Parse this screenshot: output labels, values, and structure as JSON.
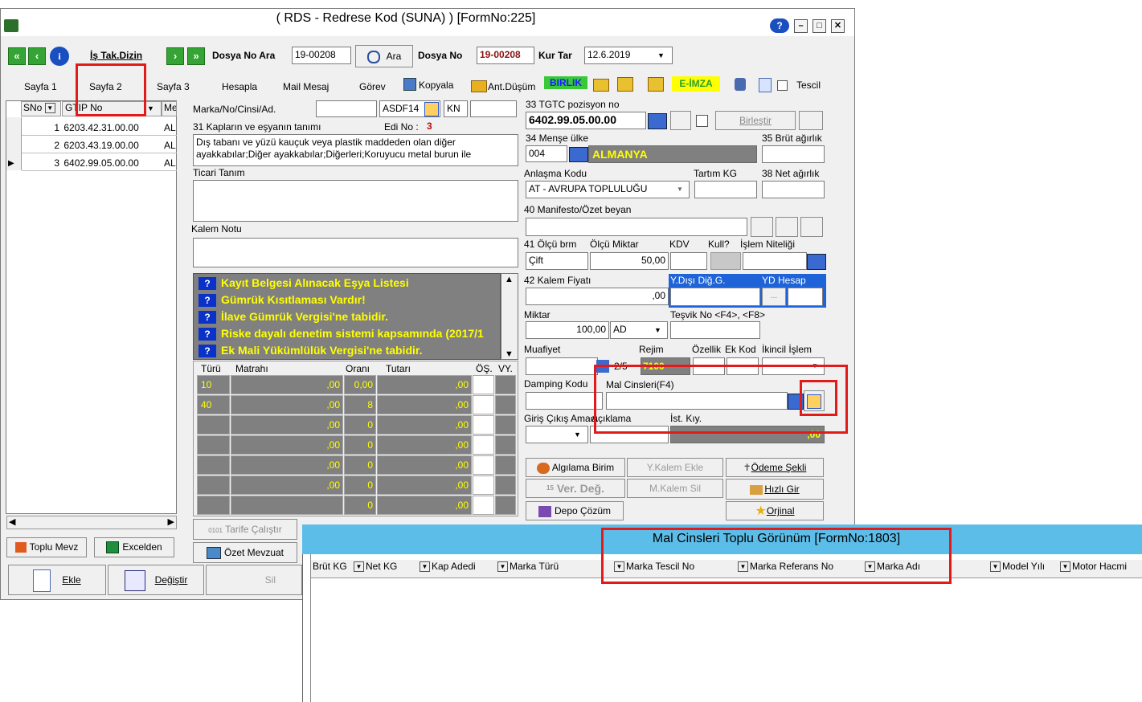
{
  "window": {
    "title": "( RDS - Redrese Kod (SUNA) ) [FormNo:225]",
    "help_label": "?",
    "minimize_label": "–",
    "maximize_label": "□",
    "close_label": "✕"
  },
  "toolbar": {
    "is_tak_dizin": "İş Tak.Dizin",
    "dosya_no_ara_label": "Dosya No Ara",
    "dosya_no_ara_value": "19-00208",
    "ara_button": "Ara",
    "dosya_no_label": "Dosya No",
    "dosya_no_value": "19-00208",
    "kur_tar_label": "Kur Tar",
    "kur_tar_value": "12.6.2019",
    "back2": "«",
    "back1": "‹",
    "fwd1": "›",
    "fwd2": "»"
  },
  "tabs": {
    "sayfa1": "Sayfa 1",
    "sayfa2": "Sayfa 2",
    "sayfa3": "Sayfa 3",
    "hesapla": "Hesapla",
    "mail_mesaj": "Mail Mesaj",
    "gorev": "Görev",
    "kopyala": "Kopyala",
    "ant_dusum": "Ant.Düşüm",
    "birlik": "BIRLIK",
    "e_imza": "E-İMZA",
    "tescil": "Tescil"
  },
  "left_grid": {
    "col_sno": "SNo",
    "col_gtip": "GTIP No",
    "col_me": "Me",
    "rows": [
      {
        "sno": "1",
        "gtip": "6203.42.31.00.00",
        "me": "AL"
      },
      {
        "sno": "2",
        "gtip": "6203.43.19.00.00",
        "me": "AL"
      },
      {
        "sno": "3",
        "gtip": "6402.99.05.00.00",
        "me": "AL"
      }
    ]
  },
  "form": {
    "marka_label": "Marka/No/Cinsi/Ad.",
    "marka_value2": "ASDF14",
    "kn_value": "KN",
    "kaplar_label": "31 Kapların ve eşyanın tanımı",
    "edi_no_label": "Edi No :",
    "edi_no_value": "3",
    "tanim_text": "Dış tabanı ve yüzü kauçuk veya plastik maddeden olan diğer ayakkabılar;Diğer ayakkabılar;Diğerleri;Koruyucu metal burun ile",
    "ticari_tanim_label": "Ticari Tanım",
    "kalem_notu_label": "Kalem Notu",
    "warnings": [
      "Kayıt Belgesi Alınacak Eşya Listesi",
      "Gümrük Kısıtlaması Vardır!",
      "İlave Gümrük Vergisi'ne tabidir.",
      "Riske dayalı denetim sistemi kapsamında (2017/1",
      "Ek Mali Yükümlülük Vergisi'ne tabidir."
    ],
    "warning_icon_label": "?"
  },
  "tax_table": {
    "col_turu": "Türü",
    "col_matrahi": "Matrahı",
    "col_orani": "Oranı",
    "col_tutari": "Tutarı",
    "col_os": "ÖŞ.",
    "col_vy": "VY.",
    "rows": [
      {
        "turu": "10",
        "matrahi": ",00",
        "orani": "0,00",
        "tutari": ",00"
      },
      {
        "turu": "40",
        "matrahi": ",00",
        "orani": "8",
        "tutari": ",00"
      },
      {
        "turu": "",
        "matrahi": ",00",
        "orani": "0",
        "tutari": ",00"
      },
      {
        "turu": "",
        "matrahi": ",00",
        "orani": "0",
        "tutari": ",00"
      },
      {
        "turu": "",
        "matrahi": ",00",
        "orani": "0",
        "tutari": ",00"
      },
      {
        "turu": "",
        "matrahi": ",00",
        "orani": "0",
        "tutari": ",00"
      },
      {
        "turu": "",
        "matrahi": "",
        "orani": "0",
        "tutari": ",00"
      }
    ]
  },
  "right_form": {
    "tgtc_label": "33 TGTC pozisyon no",
    "tgtc_value": "6402.99.05.00.00",
    "birlestir_button": "Birleştir",
    "brut_label": "35 Brüt ağırlık",
    "mense_label": "34 Menşe ülke",
    "mense_code": "004",
    "mense_name": "ALMANYA",
    "anlasma_label": "Anlaşma Kodu",
    "anlasma_value": "AT    - AVRUPA TOPLULUĞU",
    "tartim_label": "Tartım KG",
    "net_label": "38 Net ağırlık",
    "manifesto_label": "40 Manifesto/Özet beyan",
    "olcu_brm_label": "41 Ölçü brm",
    "olcu_miktar_label": "Ölçü Miktar",
    "kdv_label": "KDV",
    "kull_label": "Kull?",
    "islem_label": "İşlem Niteliği",
    "olcu_brm_value": "Çift",
    "olcu_miktar_value": "50,00",
    "kalem_fiyati_label": "42 Kalem Fiyatı",
    "kalem_fiyati_value": ",00",
    "ydisi_label": "Y.Dışı Diğ.G.",
    "yd_hesap_label": "YD Hesap",
    "yd_dots": "...",
    "miktar_label": "Miktar",
    "tesvik_label": "Teşvik No <F4>, <F8>",
    "miktar_value": "100,00",
    "miktar_unit": "AD",
    "muafiyet_label": "Muafiyet",
    "rejim_label": "Rejim",
    "ozellik_label": "Özellik",
    "ek_kod_label": "Ek Kod",
    "ikincil_label": "İkincil İşlem",
    "page_counter": "2/5",
    "rejim_value": "7100",
    "damping_label": "Damping Kodu",
    "mal_cinsleri_label": "Mal Cinsleri(F4)",
    "giris_cikis_label": "Giriş Çıkış Amacı",
    "aciklama_label": "Açıklama",
    "ist_kiy_label": "İst. Kıy.",
    "ist_kiy_value": ",00"
  },
  "action_buttons": {
    "algilama_birim": "Algılama Birim",
    "y_kalem_ekle": "Y.Kalem Ekle",
    "odeme_sekli": "Ödeme Şekli",
    "ver_deg": "Ver. Değ.",
    "ver_prefix": "15",
    "m_kalem_sil": "M.Kalem Sil",
    "hizli_gir": "Hızlı Gir",
    "depo_cozum": "Depo Çözüm",
    "orjinal": "Orjinal",
    "tarife_calistir": "Tarife Çalıştır",
    "tarife_prefix": "0101",
    "ozet_mevzuat": "Özet Mevzuat",
    "toplu_mevz": "Toplu Mevz",
    "excelden": "Excelden",
    "ekle": "Ekle",
    "degistir": "Değiştir",
    "sil": "Sil"
  },
  "sub_panel": {
    "title": "Mal Cinsleri Toplu Görünüm [FormNo:1803]",
    "columns": [
      "Brüt KG",
      "Net KG",
      "Kap Adedi",
      "Marka Türü",
      "Marka Tescil No",
      "Marka Referans No",
      "Marka Adı",
      "Model Yılı",
      "Motor Hacmi"
    ]
  },
  "colors": {
    "accent_green": "#34a534",
    "highlight_red": "#e31a1a",
    "panel_blue": "#5bbde8",
    "warn_yellow": "#ffff00",
    "dark_gray": "#808080",
    "selected_blue": "#1e64d8"
  },
  "icons": [
    "back-double-icon",
    "back-icon",
    "info-icon",
    "forward-icon",
    "forward-double-icon",
    "search-icon",
    "copy-icon",
    "folder-icon",
    "help-icon",
    "edit-icon",
    "excel-icon",
    "star-icon"
  ]
}
